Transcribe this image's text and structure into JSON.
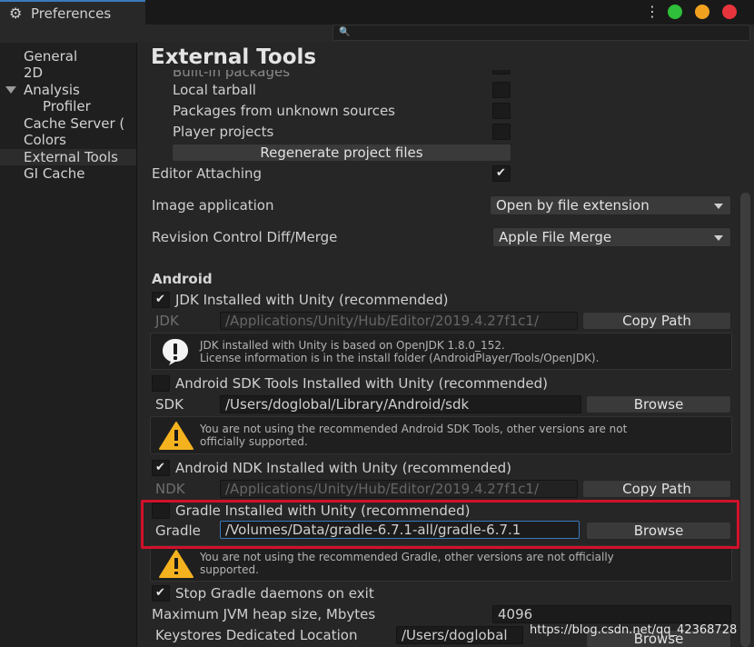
{
  "window": {
    "tab_title": "Preferences",
    "title_controls": {
      "green": "#2fbf3a",
      "yellow": "#f0a21f",
      "red": "#e8343c"
    }
  },
  "search": {
    "placeholder": ""
  },
  "sidebar": {
    "items": [
      {
        "label": "General"
      },
      {
        "label": "2D"
      },
      {
        "label": "Analysis"
      },
      {
        "label": "Profiler"
      },
      {
        "label": "Cache Server ("
      },
      {
        "label": "Colors"
      },
      {
        "label": "External Tools"
      },
      {
        "label": "GI Cache"
      }
    ]
  },
  "main": {
    "title": "External Tools",
    "packages_cut": "Built-in packages",
    "packages": [
      {
        "label": "Local tarball",
        "checked": false
      },
      {
        "label": "Packages from unknown sources",
        "checked": false
      },
      {
        "label": "Player projects",
        "checked": false
      }
    ],
    "regenerate_label": "Regenerate project files",
    "editor_attaching": {
      "label": "Editor Attaching",
      "checked": true
    },
    "image_application": {
      "label": "Image application",
      "value": "Open by file extension"
    },
    "revision_control": {
      "label": "Revision Control Diff/Merge",
      "value": "Apple File Merge"
    },
    "android": {
      "header": "Android",
      "jdk": {
        "toggle_label": "JDK Installed with Unity (recommended)",
        "checked": true,
        "field_label": "JDK",
        "path": "/Applications/Unity/Hub/Editor/2019.4.27f1c1/",
        "button": "Copy Path",
        "help_line1": "JDK installed with Unity is based on OpenJDK 1.8.0_152.",
        "help_line2": "License information is in the install folder (AndroidPlayer/Tools/OpenJDK)."
      },
      "sdk": {
        "toggle_label": "Android SDK Tools Installed with Unity (recommended)",
        "checked": false,
        "field_label": "SDK",
        "path": "/Users/doglobal/Library/Android/sdk",
        "button": "Browse",
        "help_line1": "You are not using the recommended Android SDK Tools, other versions are not",
        "help_line2": "officially supported."
      },
      "ndk": {
        "toggle_label": "Android NDK Installed with Unity (recommended)",
        "checked": true,
        "field_label": "NDK",
        "path": "/Applications/Unity/Hub/Editor/2019.4.27f1c1/",
        "button": "Copy Path"
      },
      "gradle": {
        "toggle_label": "Gradle Installed with Unity (recommended)",
        "checked": false,
        "field_label": "Gradle",
        "path": "/Volumes/Data/gradle-6.7.1-all/gradle-6.7.1",
        "button": "Browse",
        "help_line1": "You are not using the recommended Gradle, other versions are not officially",
        "help_line2": "supported."
      },
      "stop_gradle": {
        "label": "Stop Gradle daemons on exit",
        "checked": true
      },
      "jvm_heap": {
        "label": "Maximum JVM heap size, Mbytes",
        "value": "4096"
      },
      "keystores": {
        "label": "Keystores Dedicated Location",
        "path": "/Users/doglobal",
        "button": "Browse"
      }
    }
  },
  "highlight_color": "#d3102b",
  "watermark": "https://blog.csdn.net/qq_42368728"
}
